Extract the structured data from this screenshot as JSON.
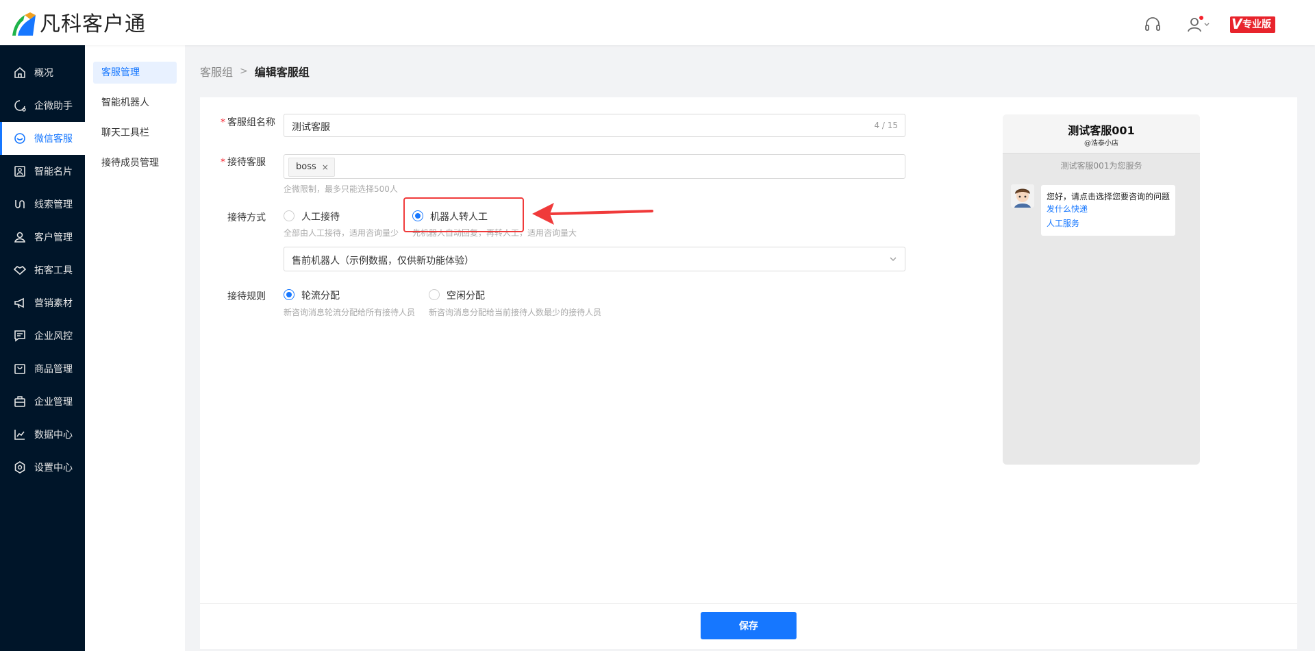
{
  "app": {
    "name": "凡科客户通",
    "edition_badge": "专业版",
    "edition_v": "V"
  },
  "colors": {
    "primary": "#1677ff",
    "nav_bg": "#001529",
    "danger": "#f5222d",
    "annotation": "#f03a3a"
  },
  "nav": {
    "items": [
      {
        "label": "概况",
        "icon": "home-icon"
      },
      {
        "label": "企微助手",
        "icon": "chat-assist-icon"
      },
      {
        "label": "微信客服",
        "icon": "wechat-service-icon",
        "active": true
      },
      {
        "label": "智能名片",
        "icon": "card-icon"
      },
      {
        "label": "线索管理",
        "icon": "leads-icon"
      },
      {
        "label": "客户管理",
        "icon": "customers-icon"
      },
      {
        "label": "拓客工具",
        "icon": "handshake-icon"
      },
      {
        "label": "营销素材",
        "icon": "megaphone-icon"
      },
      {
        "label": "企业风控",
        "icon": "risk-icon"
      },
      {
        "label": "商品管理",
        "icon": "bag-icon"
      },
      {
        "label": "企业管理",
        "icon": "briefcase-icon"
      },
      {
        "label": "数据中心",
        "icon": "chart-icon"
      },
      {
        "label": "设置中心",
        "icon": "settings-icon"
      }
    ]
  },
  "submenu": {
    "items": [
      {
        "label": "客服管理",
        "active": true
      },
      {
        "label": "智能机器人"
      },
      {
        "label": "聊天工具栏"
      },
      {
        "label": "接待成员管理"
      }
    ]
  },
  "breadcrumb": {
    "parent": "客服组",
    "separator": ">",
    "current": "编辑客服组"
  },
  "form": {
    "group_name": {
      "label": "客服组名称",
      "required_mark": "*",
      "value": "测试客服",
      "counter": "4 / 15"
    },
    "agents": {
      "label": "接待客服",
      "required_mark": "*",
      "tag": "boss",
      "tag_close": "×",
      "hint": "企微限制，最多只能选择500人"
    },
    "mode": {
      "label": "接待方式",
      "options": [
        {
          "label": "人工接待",
          "hint": "全部由人工接待，适用咨询量少",
          "checked": false
        },
        {
          "label": "机器人转人工",
          "hint": "先机器人自动回复，再转人工，适用咨询量大",
          "checked": true
        }
      ],
      "robot_select": "售前机器人（示例数据，仅供新功能体验）"
    },
    "rule": {
      "label": "接待规则",
      "options": [
        {
          "label": "轮流分配",
          "hint": "新咨询消息轮流分配给所有接待人员",
          "checked": true
        },
        {
          "label": "空闲分配",
          "hint": "新咨询消息分配给当前接待人数最少的接待人员",
          "checked": false
        }
      ]
    },
    "save_label": "保存"
  },
  "preview": {
    "title": "测试客服001",
    "subtitle": "@浩泰小店",
    "serving_text": "测试客服001为您服务",
    "greeting": "您好，请点击选择您要咨询的问题",
    "link1": "发什么快递",
    "link2": "人工服务"
  }
}
